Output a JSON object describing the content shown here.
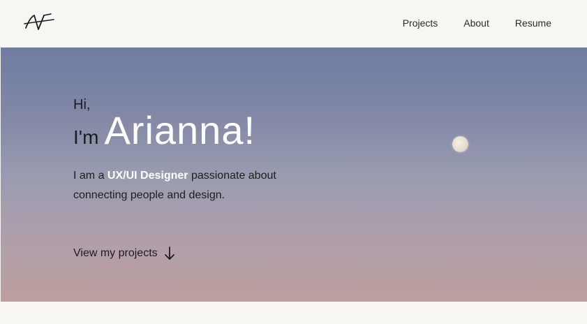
{
  "header": {
    "logo_name": "initials-logo",
    "nav": [
      {
        "label": "Projects"
      },
      {
        "label": "About"
      },
      {
        "label": "Resume"
      }
    ]
  },
  "hero": {
    "greeting": "Hi,",
    "intro_prefix": "I'm",
    "name": "Arianna!",
    "description_before": "I am a ",
    "description_role": "UX/UI Designer",
    "description_after": " passionate about connecting people and design.",
    "cta_label": "View my projects",
    "cta_icon": "arrow-down-icon"
  },
  "colors": {
    "background": "#f8f6f2",
    "sky_top": "#6f7da2",
    "sky_bottom": "#bd9f9f",
    "accent_text": "#ffffff",
    "text": "#1c1c1c"
  }
}
